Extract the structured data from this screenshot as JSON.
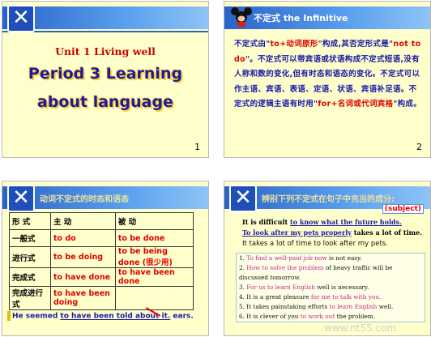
{
  "slide1": {
    "unit": "Unit 1 Living well",
    "line1": "Period 3 Learning",
    "line2": "about language",
    "page": "1"
  },
  "slide2": {
    "title": "不定式 the Infinitive",
    "p1": "不定式由\"",
    "p1red": "to+动词原形",
    "p2": "\"构成,其否定形式是\"",
    "p2red": "not to do",
    "p3": "\"。不定式可以带宾语或状语构成不定式短语,没有人称和数的变化,但有时态和语态的变化。不定式可以作主语、宾语、表语、定语、状语、宾语补足语。不定式的逻辑主语有时用\"",
    "p3red": "for+名词或代词宾格",
    "p4": "\"构成。",
    "page": "2"
  },
  "slide3": {
    "title": "动词不定式的时态和语态",
    "head": [
      "形 式",
      "主 动",
      "被 动"
    ],
    "rows": [
      [
        "一般式",
        "to do",
        "to be done"
      ],
      [
        "进行式",
        "to be doing",
        "to be being done (很少用)"
      ],
      [
        "完成式",
        "to have done",
        "to have been done"
      ],
      [
        "完成进行式",
        "to have been doing",
        ""
      ]
    ],
    "footer_a": "He seemed ",
    "footer_b": "to have been told about it.",
    "footer_c": " ears."
  },
  "slide4": {
    "title": "辨别下列不定式在句子中充当的成分:",
    "subject_tag": "(subject)",
    "t1a": "It is difficult ",
    "t1b": "to know what the future holds.",
    "t2a": "To look after my pets properly",
    "t2b": " takes a lot of time.",
    "plain": "It takes a lot of time to look after my pets.",
    "items": [
      {
        "a": "1. ",
        "b": "To find a well-paid job now",
        "c": " is not easy."
      },
      {
        "a": "2. ",
        "b": "How to solve the problem",
        "c": " of heavy traffic will be"
      },
      {
        "a": "",
        "b": "",
        "c": "discussed tomorrow."
      },
      {
        "a": "3. ",
        "b": "For us to learn English",
        "c": " well is necessary."
      },
      {
        "a": "4. It is a great pleasure ",
        "b": "for me to talk with you.",
        "c": ""
      },
      {
        "a": "5. It takes painstaking efforts ",
        "b": "to learn English",
        "c": " well."
      },
      {
        "a": "6. It is clever of you ",
        "b": "to work out",
        "c": " the problem."
      }
    ]
  },
  "watermark": "www.nt55.com"
}
